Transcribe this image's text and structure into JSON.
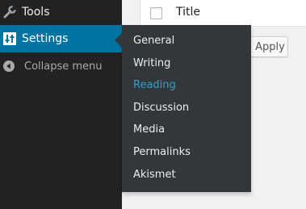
{
  "sidebar": {
    "items": [
      {
        "label": "Tools",
        "icon": "wrench-icon"
      },
      {
        "label": "Settings",
        "icon": "settings-sliders-icon",
        "active": true
      },
      {
        "label": "Collapse menu",
        "icon": "collapse-arrow-icon"
      }
    ]
  },
  "settings_submenu": {
    "items": [
      {
        "label": "General"
      },
      {
        "label": "Writing"
      },
      {
        "label": "Reading",
        "current": true
      },
      {
        "label": "Discussion"
      },
      {
        "label": "Media"
      },
      {
        "label": "Permalinks"
      },
      {
        "label": "Akismet"
      }
    ]
  },
  "content": {
    "table_header": {
      "column_title": "Title"
    },
    "bulk_actions": {
      "apply_label": "Apply"
    }
  },
  "colors": {
    "sidebar_bg": "#222222",
    "active_bg": "#0074a2",
    "flyout_bg": "#32373c",
    "current_item": "#2ea2cc"
  }
}
